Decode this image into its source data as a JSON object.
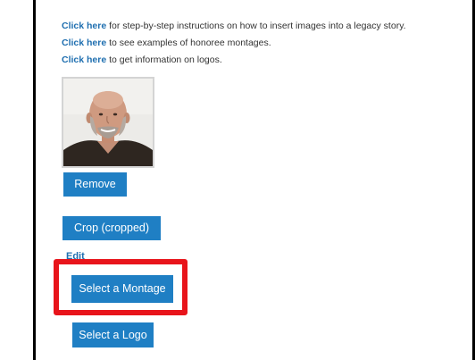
{
  "links": [
    {
      "link_text": "Click here",
      "rest": " for step-by-step instructions on how to insert images into a legacy story."
    },
    {
      "link_text": "Click here",
      "rest": " to see examples of honoree montages."
    },
    {
      "link_text": "Click here",
      "rest": " to get information on logos."
    }
  ],
  "buttons": {
    "remove": "Remove",
    "crop": "Crop (cropped)",
    "edit": "Edit",
    "select_montage": "Select a Montage",
    "select_logo": "Select a Logo"
  },
  "colors": {
    "button_bg": "#1f7fc4",
    "link": "#1f6fb0",
    "highlight": "#e8141b"
  }
}
